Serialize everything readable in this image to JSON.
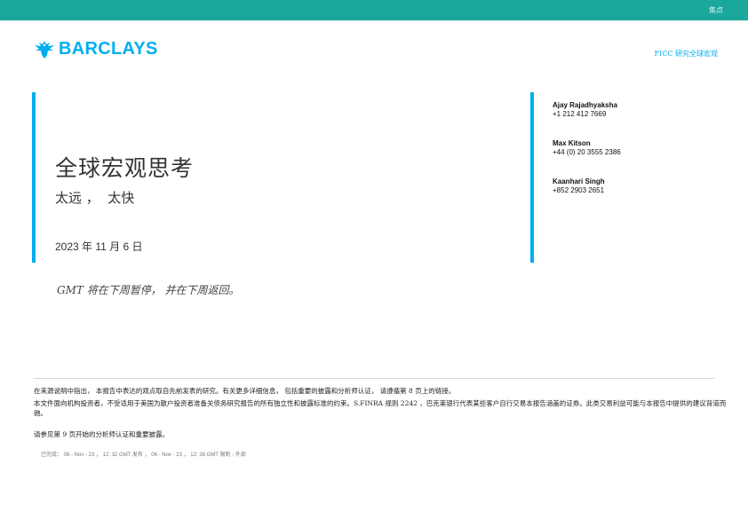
{
  "header": {
    "bar_label": "焦点",
    "accent_color": "#1aa79c"
  },
  "brand": {
    "logo_text": "BARCLAYS",
    "logo_color": "#00aeef",
    "logo_icon": "eagle-icon"
  },
  "department": {
    "label": "FICC 研究全球宏观"
  },
  "report": {
    "title": "全球宏观思考",
    "subtitle": "太远 ，  太快",
    "date": "2023 年 11 月 6 日",
    "notice": "GMT 将在下周暂停， 并在下周返回。"
  },
  "analysts": [
    {
      "name": "Ajay Rajadhyaksha",
      "phone": "+1 212 412 7669"
    },
    {
      "name": "Max Kitson",
      "phone": "+44 (0) 20 3555 2386"
    },
    {
      "name": "Kaanhari Singh",
      "phone": "+852 2903 2651"
    }
  ],
  "disclaimer": {
    "para1": "在来源说明中指出， 本报告中表达的观点取自先前发表的研究。有关更多详细信息， 包括重要的披露和分析师认证， 请遵循第 8 页上的链接。",
    "para2": "本文件面向机构投资者，不受适用于美国为散户投资者准备关债务研究报告的所有独立性和披露标准的约束。S.FINRA 规则 2242 ，巴克莱银行代表某些客户自行交易本报告涵盖的证券。此类交易利益可能与本报告中提供的建议背道而驰。",
    "para3": "请参见第 9 页开始的分析师认证和重要披露。",
    "completed": "已完成： 06 - Nov - 23 ， 12: 32 GMT 发布 ， 06 - Nov - 23 ， 12: 36 GMT 限制 - 外部"
  }
}
